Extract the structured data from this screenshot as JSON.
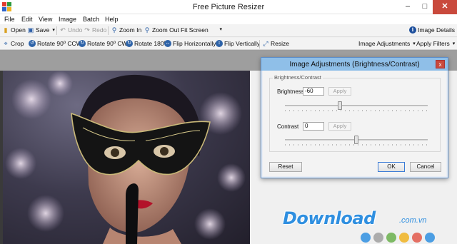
{
  "window": {
    "title": "Free Picture Resizer",
    "min_icon": "minimize-icon",
    "max_icon": "maximize-icon",
    "close_icon": "close-icon"
  },
  "menu": [
    {
      "label": "File"
    },
    {
      "label": "Edit"
    },
    {
      "label": "View"
    },
    {
      "label": "Image"
    },
    {
      "label": "Batch"
    },
    {
      "label": "Help"
    }
  ],
  "toolbar1": {
    "open": "Open",
    "save": "Save",
    "undo": "Undo",
    "redo": "Redo",
    "zoom_in": "Zoom In",
    "zoom_out": "Zoom Out",
    "fit_screen": "Fit Screen",
    "image_details": "Image Details"
  },
  "toolbar2": {
    "crop": "Crop",
    "rotate_ccw": "Rotate 90º CCW",
    "rotate_cw": "Rotate 90º CW",
    "rotate_180": "Rotate 180º",
    "flip_h": "Flip Horizontally",
    "flip_v": "Flip Vertically",
    "resize": "Resize",
    "image_adjustments": "Image Adjustments",
    "apply_filters": "Apply Filters"
  },
  "dialog": {
    "title": "Image Adjustments (Brightness/Contrast)",
    "close_label": "x",
    "group_label": "Brightness/Contrast",
    "brightness_label": "Brightness",
    "brightness_value": "-60",
    "contrast_label": "Contrast",
    "contrast_value": "0",
    "apply_label": "Apply",
    "brightness_level": -60,
    "contrast_level": 0,
    "reset": "Reset",
    "ok": "OK",
    "cancel": "Cancel"
  },
  "watermark": {
    "text": "Download",
    "tld": ".com.vn"
  },
  "colors": {
    "dialog_title_bg": "#8fbfe8",
    "watermark": "#2f8fe0",
    "close_red": "#c9493c"
  }
}
